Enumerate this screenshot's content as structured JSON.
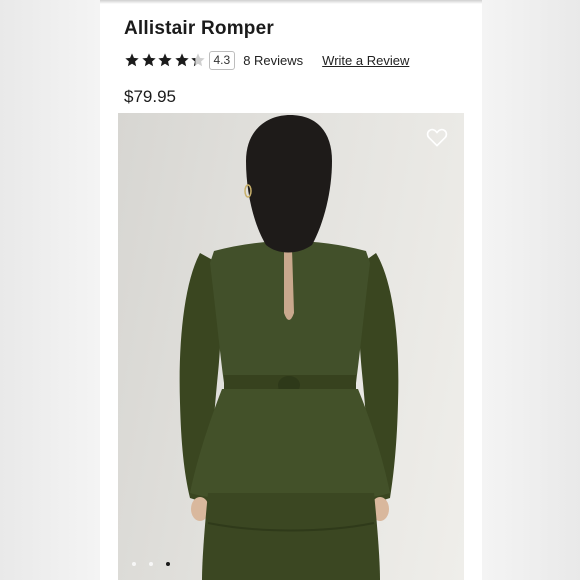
{
  "product": {
    "title": "Allistair Romper",
    "rating": 4.3,
    "rating_label": "4.3",
    "reviews_label": "8 Reviews",
    "write_review_label": "Write a Review",
    "price": "$79.95"
  },
  "gallery": {
    "image_count": 3,
    "active_index": 2,
    "wishlist_icon": "heart-outline-icon"
  },
  "colors": {
    "star": "#1b1b1b",
    "garment": "#3e4a22",
    "background": "#e3e2de"
  }
}
